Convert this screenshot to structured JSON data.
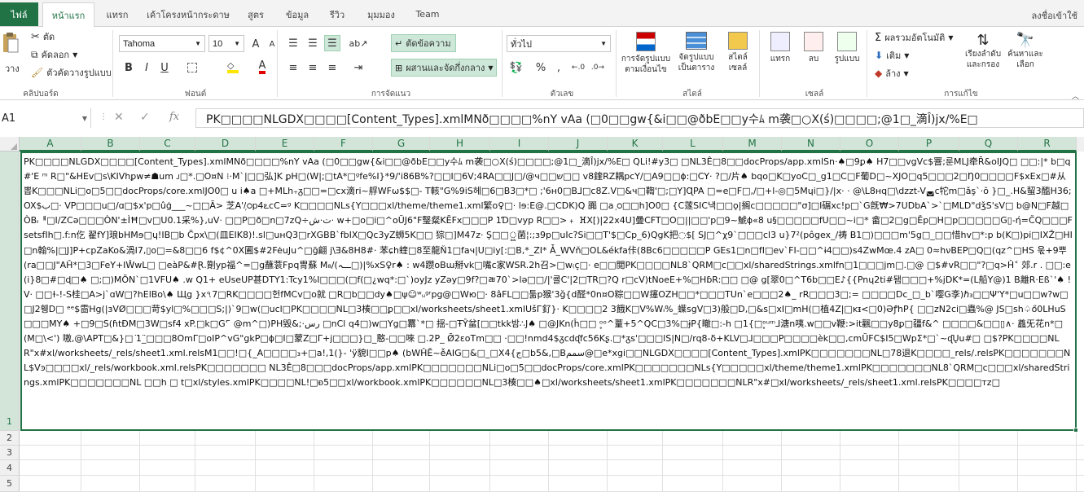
{
  "ribbon_tabs": {
    "file": "ไฟล์",
    "home": "หน้าแรก",
    "insert": "แทรก",
    "page_layout": "เค้าโครงหน้ากระดาษ",
    "formulas": "สูตร",
    "data": "ข้อมูล",
    "review": "รีวิว",
    "view": "มุมมอง",
    "team": "Team",
    "signin": "ลงชื่อเข้าใช้"
  },
  "clipboard": {
    "paste": "วาง",
    "cut": "ตัด",
    "copy": "คัดลอก",
    "format_painter": "ตัวคัดวางรูปแบบ",
    "label": "คลิปบอร์ด"
  },
  "font": {
    "name": "Tahoma",
    "size": "10",
    "bold": "B",
    "italic": "I",
    "underline": "U",
    "font_color_letter": "A",
    "grow": "A",
    "shrink": "A",
    "label": "ฟอนต์"
  },
  "alignment": {
    "wrap_text": "ตัดข้อความ",
    "merge_center": "ผสานและจัดกึ่งกลาง",
    "label": "การจัดแนว"
  },
  "number": {
    "format": "ทั่วไป",
    "label": "ตัวเลข",
    "percent": "%",
    "comma": ","
  },
  "styles": {
    "conditional_line1": "การจัดรูปแบบ",
    "conditional_line2": "ตามเงื่อนไข",
    "table_line1": "จัดรูปแบบ",
    "table_line2": "เป็นตาราง",
    "cell_line1": "สไตล์",
    "cell_line2": "เซลล์",
    "label": "สไตล์"
  },
  "cells": {
    "insert": "แทรก",
    "delete": "ลบ",
    "format": "รูปแบบ",
    "label": "เซลล์"
  },
  "editing": {
    "autosum": "ผลรวมอัตโนมัติ",
    "fill": "เติม",
    "clear": "ล้าง",
    "sort_line1": "เรียงลำดับ",
    "sort_line2": "และกรอง",
    "find_line1": "ค้นหาและ",
    "find_line2": "เลือก",
    "label": "การแก้ไข"
  },
  "formula_bar": {
    "name_box": "A1",
    "fx": "fx",
    "content": "PK□□□□NLGDX□□□□[Content_Types].xmlMNð□□□□%nY vAa (□0□□gw{&i□□@ðbE□□y수ﾑ m袭□○X(ś)□□□□;@1□_滴Î)jx/%E□"
  },
  "columns": [
    "A",
    "B",
    "C",
    "D",
    "E",
    "F",
    "G",
    "H",
    "I",
    "J",
    "K",
    "L",
    "M",
    "N",
    "O",
    "P",
    "Q",
    "R"
  ],
  "rows": [
    "1",
    "2",
    "3",
    "4",
    "5"
  ],
  "cell_a1_text": "PK□□□□NLGDX□□□□[Content_Types].xmlMNð□□□□%nY vAa (□0□□gw{&i□□@ðbE□□y수ﾑ m袭□○X(ś)□□□□;@1□_滴Î)jx/%E□ QLi!#y3□ □NL3Ê□8□□docProps/app.xmlSn·♠□9ꝑ♠ H7□□vgVc$罯;룬MLJ牵R̄&oIJQ□ □□:|* b□q#'E ᵐ R□\"&HEv□s\\KIVhꝑw≠☗um ᴊ□*.□O¤N ⁝·M`|□□弘]K ꝑH□(W|;□tA*□ᵍfe%I}*9/'i86B%?□□I□6V;4RA□□J□/@ч□□ש□□ v8鍷RZ耦pcY/□A9□□ɸ:□CY· ?□/片♠ bqo□K□yoC□_g1□C□F葡D□~XJO□q5□□□2□Ŋ0□□□□F$xEx□#从 뽑K□□□NLi□o□5□□docProps/core.xmlJO0□ u i♠a □+MLh₊ᵹ□□=□cx滴ri~艀WFω$$□- T輆\"G%9iS헤□6□B3□*□ ;'6ʜ0□B⅃□c8Z.V□&ч□鞫'□;□Y]ɊPA □=e□F□,/□+l-◎□5Mɥi□}/|x· · @\\L8ʜq□\\dzzt-V◛c㸰m□ǎş`·ŏ }□_.H&蛪3醢H36;OX$ب□· VP□□□u□/ɑ□$x'p□ûģ___~□□Ã> 芝A'/᷊ഠp4ఽcC=ᵍ K□□□□NLs{Y□□□xl/theme/theme1.xml繁o♀□· lɘ:E@.□CDK)Q 嚻 □a ᷊ഠ□□h]O0□ {C蓫SIC낵□□ǫ|搁c□□□□□\"σ]□Ι碿xc!p□`G旣₩>7UDbA`>`□MLD\"dǯS'sV□ b@N□F越□ÒB៲ᅤ□I/ZCə□□□ÒN'±ÌĦ□v□U0.1采%},uV· □□P□ð□n□7zQ÷ت·ش· w+□o□i□^oŬJ6\"F瑿粲KĔFx□□□P 1Ɗ□vyp R□□>﹢ ⴼX[)|22x4U]曡CFT□O□||□□'p□9~鯱ϕ«8 u§□□□□□fU□□~i□* 畲□2□g□Ěp□H□p□□□□□G▯-ή=ČQ□□□FsetsfIh□.f:n仡 翟fY]琅bHMɘ□ɥ!IB□b C̈px\\□(皿ΕΙΚ8)!.sl□uʜQ3□rXGBB`fbIX□Qc3yZ蛳5K□□ 猔□]M47z· Ş□□ৣ菌¦:;ɜ9p□uIc?Si□□T'$□Cp_6)QgK把◌$[ SJ□^χ9`□□□cl3 u}7²(pôgex_/祷 B1□)□□□m'5g□_□□惜hv□*:p b(K□)pi□IXŽ□HI□n翰%|□J]P+cpZaKo&渦I7,▯o□=&8□□6 f$¢^0X圃$#2FėuJu^□ḡ翩 j\\Ǝ&8H8#· 苯ɕh蝰□8至龍Ň1□faч|U□iy[:□B,*_ZI* Ǡ_WVň□OL&ékfa佧(8Bc6□□□□□P GEs1□n□fI□ev`FI-□□^ɨ4□□)s4ZwMœ.4 zA□ 0≈hνBEP□Q□(qz^□HS 욳+9뿌(ra□□J\"AĤ*□3□FeY+IŴwL□ □eàP&#Ɽ.劕yp福^=□g蘸蓘Fpq冑蘇 M₈/(ـــہ□)|%xS♀r♠ : w4躜oBɯ掰vk□嘴c家WSR.2h召>□w₍c̟□· e□□閲PK□□□□NL8`QRM□c□□xl/sharedStrings.xmlfn□1□□□jm□.□@ □$#vR□□\"?□q>Ĥ˂ 郊.r . □□:e(i}8□#□ɖ□♠ □;□)MÕN`□1VFU♠ .w Q1+ eUseUP甚DTY1:Tcy1%I□□□(□f(□¿wq*:□`)oyJz yZəy□9f?□ㄼ70`>lə□□/|'쿌C'|2□TR□?Q r□cV)tNoeE+%□HɓR:□□ □@ g[翠0□^T6b□□E♪{{Pnų2ti#됌□□□+%jDK*=(L船Y@)1 B離R·Eß`'♠ ! V· □□ɫ-!-S桂□A>j`ɑW□?hElBo\\♠ Щg }x৭7□RK□□□□헌fMCv□o就 □R□b□□dy♠□ψ☺ʷᵤᵍʳpg@□Wю□· 8âFL□□툶p猴'3ǧ{d醛*0n¤O粽□□W㩙OZH□□*□□□TUn`e□□□2♠_ rR□□□3□;= □□□□Dc_□_b`嘤G斈)ℏ₃□□Ψ'Y*□u□□w?w□□J2휑D□ ᵉᵉ$䨓Hg(|ɜVØ□□□苛$yl□%□□□S;|)`9□w(□ucl□PK□□□□NL□3楱□□ꝑ□□xl/worksheets/sheet1.xmlUšГ釕}· K□□□□2 3餓K□V%W៲%_蠂sgV□3)般□D,□&s□xI□mH(□植4Z|□ᴋᵻ<□0)ƏꝭhP{ □□zN2ci□蟲%@ JS□sh♤ő0LHuS□□□MY♠ +□9□S(ɦtĐM□3W□sf4 xP.□k□G' ̄ @m^□)PH毀&;·رس □nCl q4□)w□Yg□羃`*□ 揺-□ŦŶ蚠[□□tkk밤∴J♠ □@JKn(ĥ□□ ᵒ̥ᵒ^蕫+5^QC□3%□ɉP{瞮□:-h □1{□ᵒ̥ᵘᵐ⅃溏n咦.w□□v鞭:>it飌□□y8ꝑ□疆f&^ □□□□&□□▯∧· 蠤旡花n*□(M□\\<') 嗷,@\\APT□&}□ ͘1_̈□□□8OmΓ□oIP^vG\"gkP□ɸ□I□蒙Z□Γ+j□□□}□_憨-□□唻 □.2P_ Ō̸2εoTm□□ ·□□!nmd4$ᵹcdᶑfc56Kʂ.□*ᵹs'□□□lS|N□/rq8-δ+KLV□⅃□□□P□□□□èk□□,cmŨFC$I5□WpΣ*□`~ᶑŲu#□ □$?PK□□□□NLR\"x#xl/worksheets/_rels/sheet1.xml.relsM1□□!□{_A□□□□₃+□a!,1(}- 'ÿ貌I□□p♠ (bWĤĔ~ễAIG□&□_□X4{ج□b5&,□Bسمم@□e*xgi□□NLGDX□□□□[Content_Types].xmlPK□□□□□□□NL□78退K□□□□_rels/.relsPK□□□□□□□NL$Vͽ□□□□xl/_rels/workbook.xml.relsPK□□□□□□□ NL3Ê□8□□□docProps/app.xmlPK□□□□□□□NLi□o□5□□docProps/core.xmlPK□□□□□□□NLs{Y□□□□□xl/theme/theme1.xmlPK□□□□□□□NL8`QRM□c□□□xl/sharedStrings.xmlPK□□□□□□□NL □□h □ t□xl/styles.xmlPK□□□□NL!□ᴆ5□□xl/workbook.xmlPK□□□□□□NL□3楱□□♠□xl/worksheets/sheet1.xmlPK□□□□□□□NLR\"x#□xl/worksheets/_rels/sheet1.xml.relsPK□□□□ᴛz□",
  "colors": {
    "accent": "#217346",
    "grid": "#e0e0e0",
    "header_bg": "#f0f0f0"
  }
}
